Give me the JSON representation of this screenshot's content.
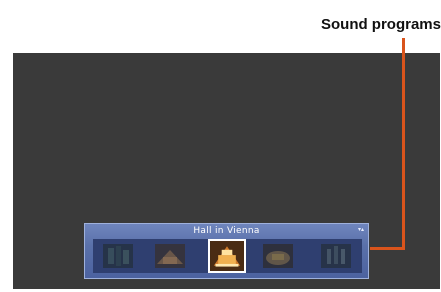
{
  "callout": {
    "label": "Sound programs"
  },
  "osd": {
    "title": "Hall in Vienna",
    "scroll_indicator": "⬍",
    "programs": [
      {
        "icon": "dark-hall-icon",
        "selected": false
      },
      {
        "icon": "stage-hall-icon",
        "selected": false
      },
      {
        "icon": "vienna-hall-icon",
        "selected": true
      },
      {
        "icon": "theater-hall-icon",
        "selected": false
      },
      {
        "icon": "cathedral-hall-icon",
        "selected": false
      }
    ]
  },
  "colors": {
    "leader_line": "#d9541c",
    "panel": "#5a71aa",
    "screen": "#3a3a3a"
  }
}
